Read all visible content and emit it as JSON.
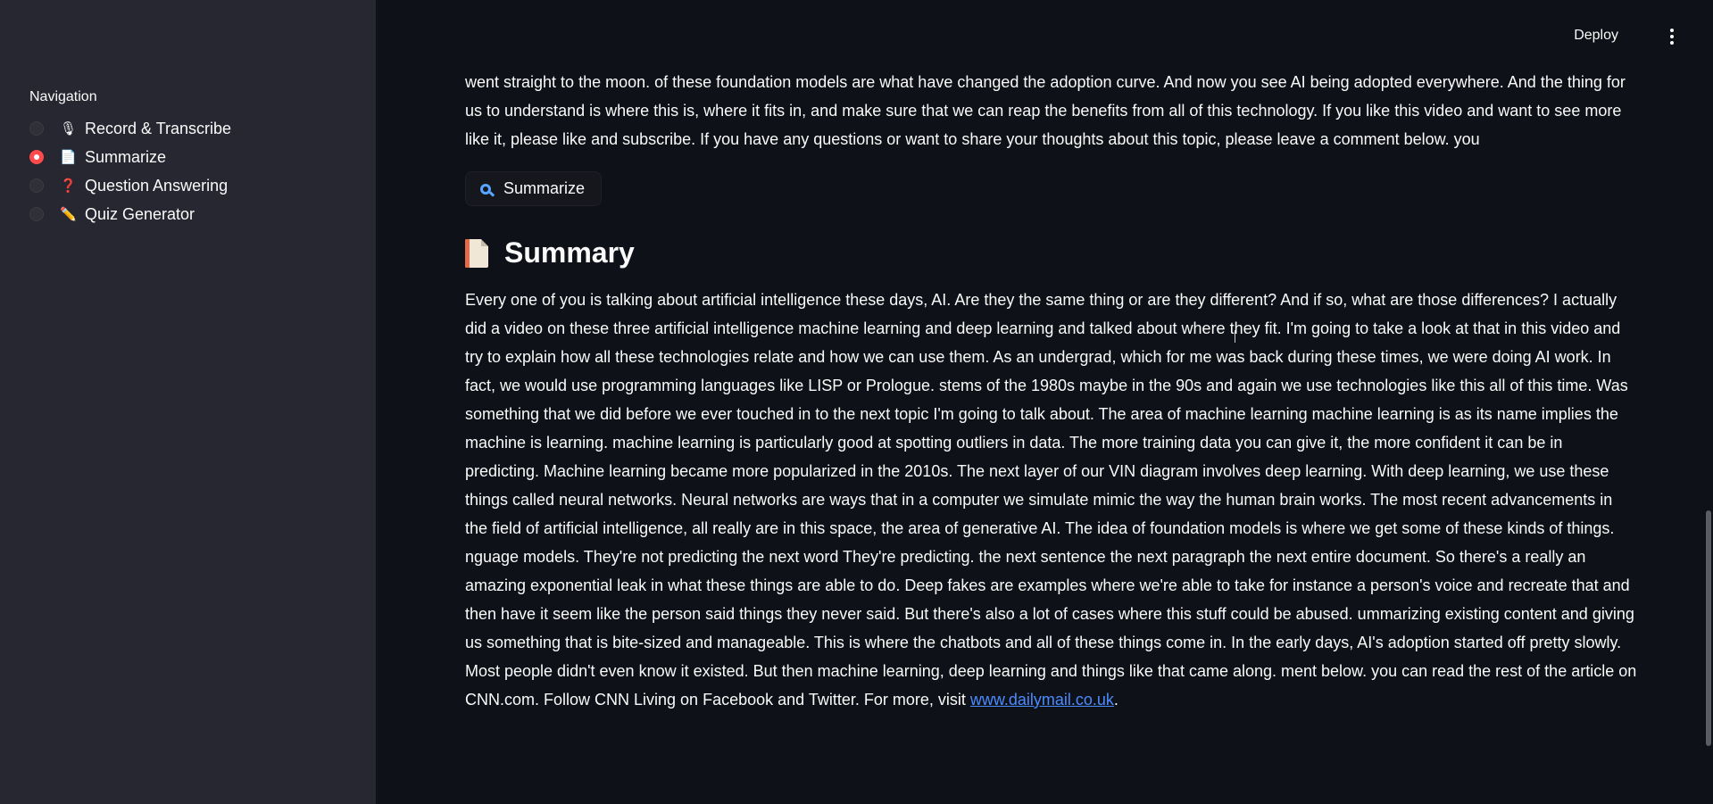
{
  "sidebar": {
    "title": "Navigation",
    "items": [
      {
        "label": "Record & Transcribe",
        "emoji": "🎙",
        "selected": false
      },
      {
        "label": "Summarize",
        "emoji": "📄",
        "selected": true
      },
      {
        "label": "Question Answering",
        "emoji": "❓",
        "selected": false
      },
      {
        "label": "Quiz Generator",
        "emoji": "✏️",
        "selected": false
      }
    ]
  },
  "header": {
    "deploy_label": "Deploy",
    "menu_icon": "kebab-menu-icon"
  },
  "main": {
    "transcript_tail": "went straight to the moon. of these foundation models are what have changed the adoption curve. And now you see AI being adopted everywhere. And the thing for us to understand is where this is, where it fits in, and make sure that we can reap the benefits from all of this technology. If you like this video and want to see more like it, please like and subscribe. If you have any questions or want to share your thoughts about this topic, please leave a comment below. you",
    "summarize_button_label": "Summarize",
    "summary_heading": "Summary",
    "summary_text": "Every one of you is talking about artificial intelligence these days, AI. Are they the same thing or are they different? And if so, what are those differences? I actually did a video on these three artificial intelligence machine learning and deep learning and talked about where they fit. I'm going to take a look at that in this video and try to explain how all these technologies relate and how we can use them. As an undergrad, which for me was back during these times, we were doing AI work. In fact, we would use programming languages like LISP or Prologue. stems of the 1980s maybe in the 90s and again we use technologies like this all of this time. Was something that we did before we ever touched in to the next topic I'm going to talk about. The area of machine learning machine learning is as its name implies the machine is learning. machine learning is particularly good at spotting outliers in data. The more training data you can give it, the more confident it can be in predicting. Machine learning became more popularized in the 2010s. The next layer of our VIN diagram involves deep learning. With deep learning, we use these things called neural networks. Neural networks are ways that in a computer we simulate mimic the way the human brain works. The most recent advancements in the field of artificial intelligence, all really are in this space, the area of generative AI. The idea of foundation models is where we get some of these kinds of things. nguage models. They're not predicting the next word They're predicting. the next sentence the next paragraph the next entire document. So there's a really an amazing exponential leak in what these things are able to do. Deep fakes are examples where we're able to take for instance a person's voice and recreate that and then have it seem like the person said things they never said. But there's also a lot of cases where this stuff could be abused. ummarizing existing content and giving us something that is bite-sized and manageable. This is where the chatbots and all of these things come in. In the early days, AI's adoption started off pretty slowly. Most people didn't even know it existed. But then machine learning, deep learning and things like that came along. ment below. you can read the rest of the article on CNN.com. Follow CNN Living on Facebook and Twitter. For more, visit ",
    "summary_link": "www.dailymail.co.uk",
    "summary_end": "."
  },
  "colors": {
    "background": "#0e1117",
    "sidebar": "#262730",
    "accent": "#ff4b4b",
    "link": "#4a8cff"
  }
}
